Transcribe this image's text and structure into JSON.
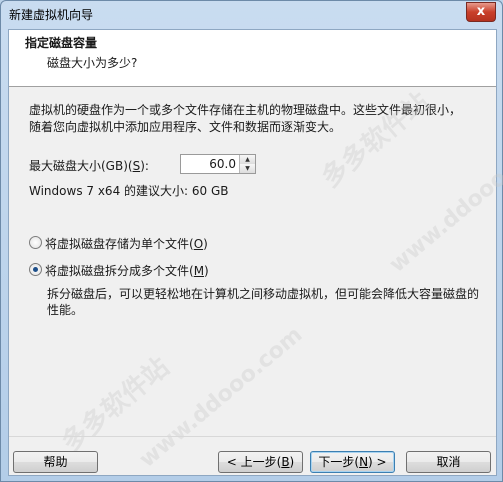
{
  "window": {
    "title": "新建虚拟机向导",
    "close_glyph": "x"
  },
  "header": {
    "title": "指定磁盘容量",
    "subtitle": "磁盘大小为多少?"
  },
  "description": "虚拟机的硬盘作为一个或多个文件存储在主机的物理磁盘中。这些文件最初很小，随着您向虚拟机中添加应用程序、文件和数据而逐渐变大。",
  "disk_size": {
    "label_prefix": "最大磁盘大小(GB)(",
    "label_key": "S",
    "label_suffix": "):",
    "value": "60.0",
    "recommend": "Windows 7 x64 的建议大小: 60 GB"
  },
  "options": [
    {
      "prefix": "将虚拟磁盘存储为单个文件(",
      "key": "O",
      "suffix": ")",
      "checked": false
    },
    {
      "prefix": "将虚拟磁盘拆分成多个文件(",
      "key": "M",
      "suffix": ")",
      "checked": true
    }
  ],
  "split_description": "拆分磁盘后，可以更轻松地在计算机之间移动虚拟机，但可能会降低大容量磁盘的性能。",
  "buttons": {
    "help": "帮助",
    "back_prefix": "< 上一步(",
    "back_key": "B",
    "back_suffix": ")",
    "next_prefix": "下一步(",
    "next_key": "N",
    "next_suffix": ") >",
    "cancel": "取消"
  },
  "watermark": {
    "cn": "多多软件站",
    "url": "www.ddooo.com"
  }
}
